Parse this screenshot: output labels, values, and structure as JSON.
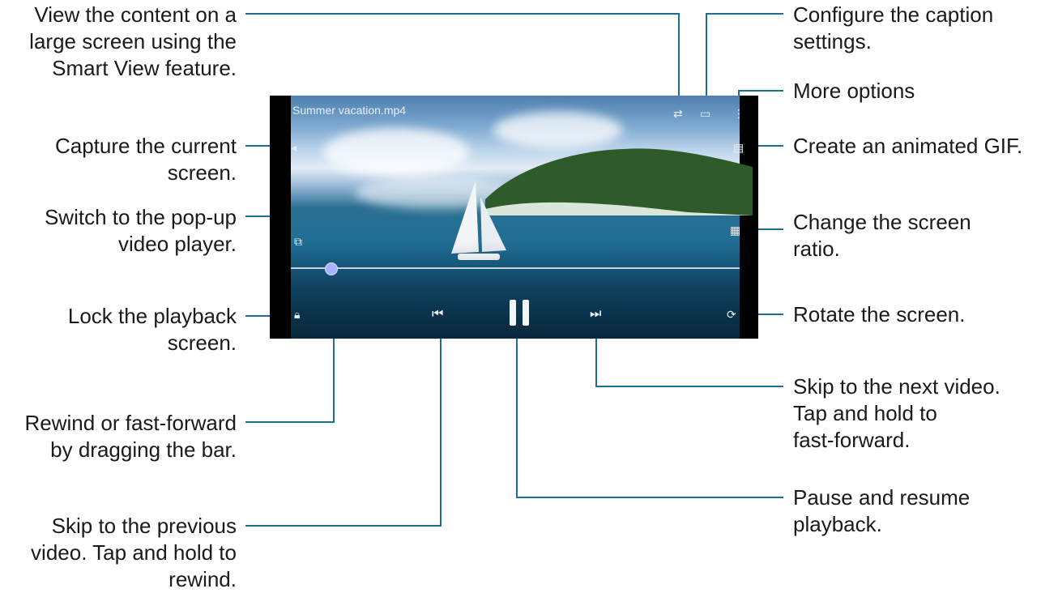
{
  "callouts": {
    "smart_view": "View the content on a\nlarge screen using the\nSmart View feature.",
    "capture": "Capture the current\nscreen.",
    "popup": "Switch to the pop-up\nvideo player.",
    "lock": "Lock the playback\nscreen.",
    "seek": "Rewind or fast-forward\nby dragging the bar.",
    "previous": "Skip to the previous\nvideo. Tap and hold to\nrewind.",
    "caption": "Configure the caption\nsettings.",
    "more": "More options",
    "gif": "Create an animated GIF.",
    "ratio": "Change the screen\nratio.",
    "rotate": "Rotate the screen.",
    "next": "Skip to the next video.\nTap and hold to\nfast-forward.",
    "pause": "Pause and resume\nplayback."
  },
  "player": {
    "file_name": "Summer vacation.mp4",
    "progress": 0.09
  },
  "icons": {
    "smart_view": "smart-view-icon",
    "caption": "caption-icon",
    "more": "more-options-icon",
    "capture": "capture-icon",
    "gif": "gif-icon",
    "popup": "popup-player-icon",
    "ratio": "screen-ratio-icon",
    "lock": "lock-icon",
    "previous": "previous-icon",
    "pause": "pause-icon",
    "next": "next-icon",
    "rotate": "rotate-icon"
  },
  "colors": {
    "leader_line": "#1f6f95",
    "text": "#1a1a1a"
  }
}
